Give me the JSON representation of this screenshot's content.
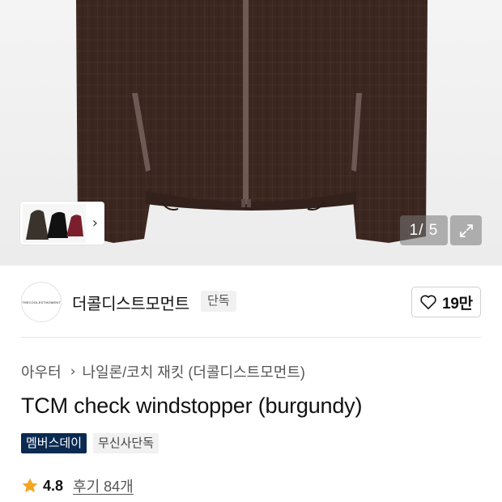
{
  "gallery": {
    "current": 1,
    "total": 5,
    "counter_text": "1/ 5",
    "thumb_colors": [
      "#3a332c",
      "#111111",
      "#7a1f2b"
    ],
    "jacket_color": "#3b2620"
  },
  "brand": {
    "logo_text": "THECOOLESTMOMENT",
    "name": "더콜디스트모먼트",
    "badge": "단독",
    "like_count": "19만"
  },
  "breadcrumb": {
    "category": "아우터",
    "subcategory": "나일론/코치 재킷 (더콜디스트모먼트)"
  },
  "product": {
    "title": "TCM check windstopper (burgundy)",
    "tags": [
      "멤버스데이",
      "무신사단독"
    ]
  },
  "rating": {
    "score": "4.8",
    "reviews": "후기 84개",
    "star_color": "#f5a623"
  }
}
